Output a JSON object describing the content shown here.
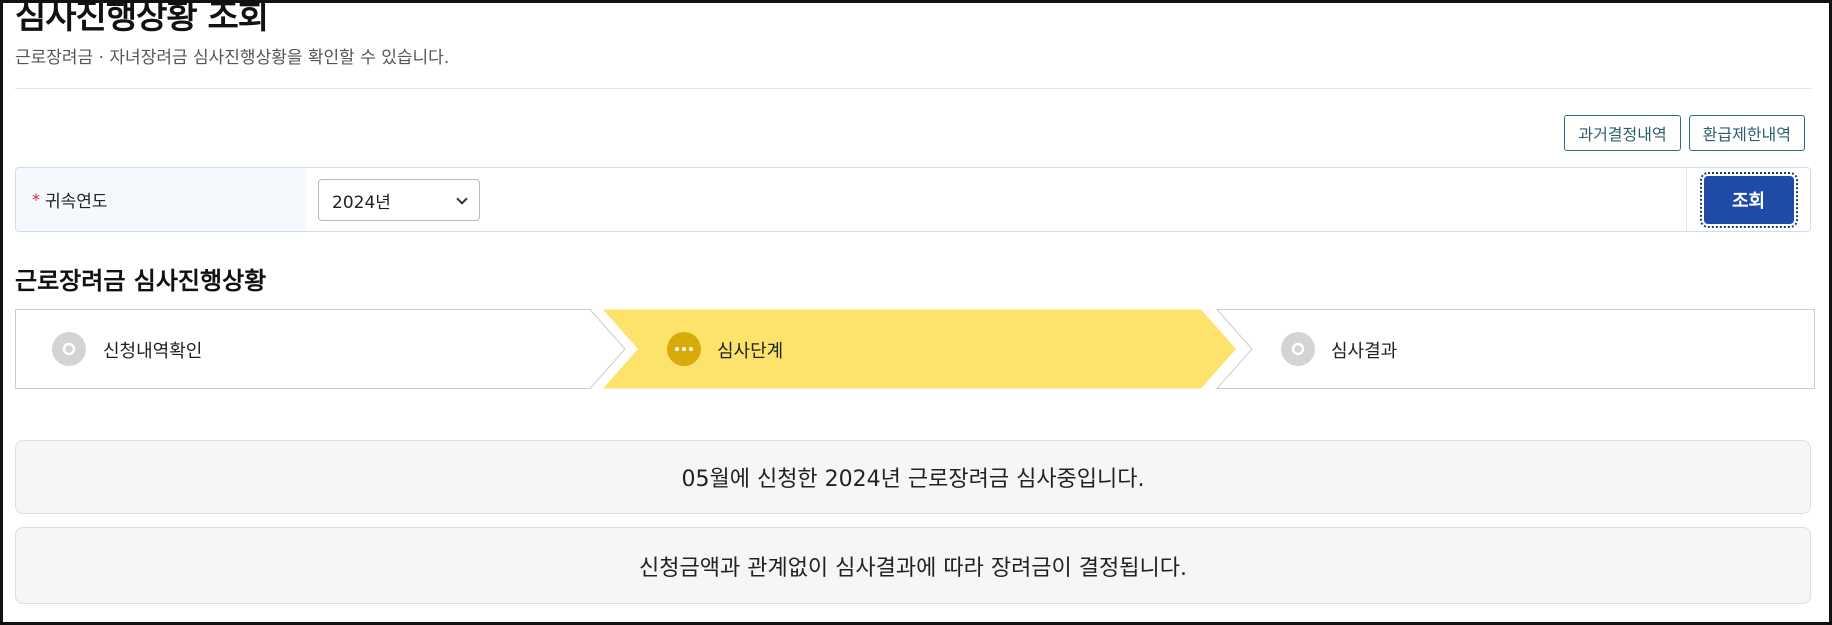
{
  "page": {
    "title": "심사진행상황 조회",
    "description": "근로장려금 · 자녀장려금 심사진행상황을 확인할 수 있습니다."
  },
  "top_buttons": {
    "past_decisions": "과거결정내역",
    "refund_restrictions": "환급제한내역"
  },
  "search": {
    "required_mark": "*",
    "label": "귀속연도",
    "year_value": "2024년",
    "submit_label": "조회"
  },
  "progress": {
    "section_title": "근로장려금 심사진행상황",
    "steps": [
      {
        "label": "신청내역확인",
        "state": "pending"
      },
      {
        "label": "심사단계",
        "state": "current"
      },
      {
        "label": "심사결과",
        "state": "pending"
      }
    ]
  },
  "messages": {
    "status": "05월에 신청한 2024년 근로장려금 심사중입니다.",
    "note": "신청금액과 관계없이 심사결과에 따라 장려금이 결정됩니다."
  },
  "colors": {
    "current_step_fill": "#fde36b",
    "current_step_icon": "#d8ab0a",
    "pending_step_icon": "#d4d4d4",
    "primary_button": "#1f4aa6"
  }
}
